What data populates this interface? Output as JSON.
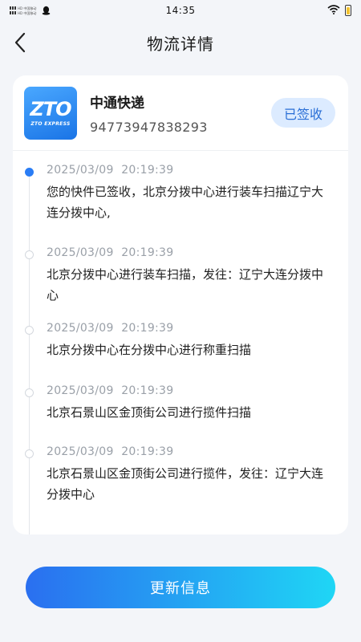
{
  "status_bar": {
    "time": "14:35",
    "signal_line1": "HD 中国移动",
    "signal_line2": "HD 中国移动",
    "icons": [
      "signal-icon",
      "qq-icon",
      "wifi-icon",
      "battery-icon"
    ]
  },
  "nav": {
    "title": "物流详情",
    "back_icon": "chevron-left-icon"
  },
  "package": {
    "logo_mark": "ZTO",
    "logo_sub": "ZTO EXPRESS",
    "company": "中通快递",
    "tracking_number": "94773947838293",
    "status": "已签收"
  },
  "events": [
    {
      "time": "2025/03/09  20:19:39",
      "desc": "您的快件已签收，北京分拨中心进行装车扫描辽宁大连分拨中心,",
      "active": true
    },
    {
      "time": "2025/03/09  20:19:39",
      "desc": "北京分拨中心进行装车扫描，发往：辽宁大连分拨中心",
      "active": false
    },
    {
      "time": "2025/03/09  20:19:39",
      "desc": "北京分拨中心在分拨中心进行称重扫描",
      "active": false
    },
    {
      "time": "2025/03/09  20:19:39",
      "desc": "北京石景山区金顶街公司进行揽件扫描",
      "active": false
    },
    {
      "time": "2025/03/09  20:19:39",
      "desc": "北京石景山区金顶街公司进行揽件，发往：辽宁大连分拨中心",
      "active": false
    }
  ],
  "actions": {
    "update_label": "更新信息"
  },
  "colors": {
    "accent": "#2a7df5",
    "badge_bg": "#dcebff",
    "button_gradient_start": "#2a6ff0",
    "button_gradient_end": "#1fd6f5"
  }
}
